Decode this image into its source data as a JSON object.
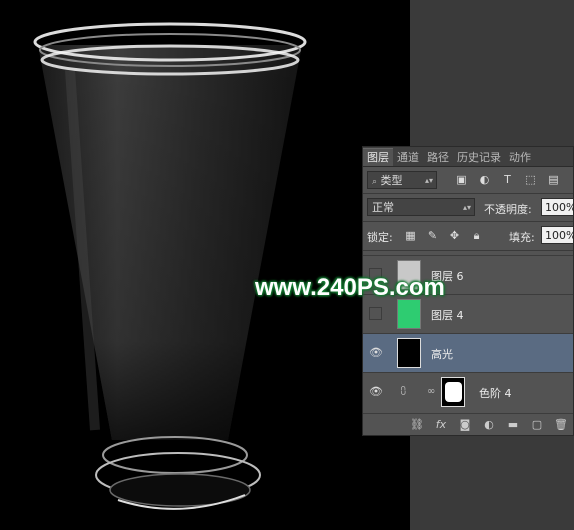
{
  "watermark": "www.240PS.com",
  "panel": {
    "tabs": [
      "图层",
      "通道",
      "路径",
      "历史记录",
      "动作"
    ],
    "filter": {
      "kind": "类型",
      "icons": [
        "image-filter-icon",
        "adjustment-filter-icon",
        "type-filter-icon",
        "shape-filter-icon",
        "smart-object-filter-icon"
      ]
    },
    "blend_mode": "正常",
    "opacity_label": "不透明度:",
    "opacity_value": "100%",
    "lock_label": "锁定:",
    "fill_label": "填充:",
    "fill_value": "100%",
    "layers": [
      {
        "name": "图层 6",
        "visible": false,
        "thumb_color": "#c8c8c8"
      },
      {
        "name": "图层 4",
        "visible": false,
        "thumb_color": "#2ecc71"
      },
      {
        "name": "高光",
        "visible": true,
        "selected": true,
        "thumb_color": "#000000"
      },
      {
        "name": "色阶 4",
        "visible": true,
        "thumb_color": "#ffffff"
      }
    ],
    "bottom_icons": [
      "link-layers-icon",
      "fx-icon",
      "add-mask-icon",
      "new-adjustment-icon",
      "new-group-icon",
      "new-layer-icon",
      "delete-layer-icon"
    ]
  }
}
